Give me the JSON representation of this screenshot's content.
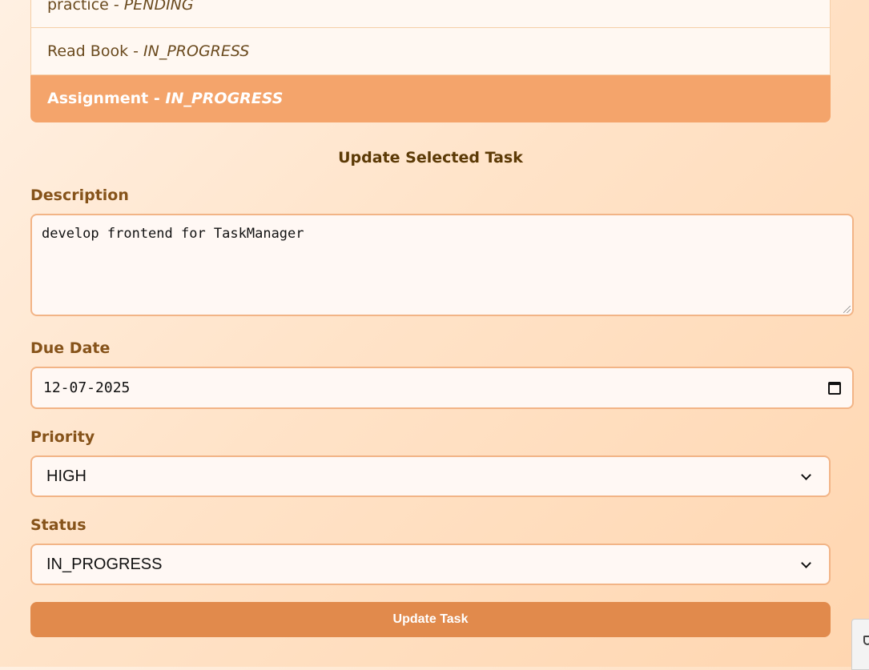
{
  "task_list": {
    "items": [
      {
        "name": "practice",
        "separator": " - ",
        "status": "PENDING",
        "selected": false
      },
      {
        "name": "Read Book",
        "separator": " - ",
        "status": "IN_PROGRESS",
        "selected": false
      },
      {
        "name": "Assignment",
        "separator": " - ",
        "status": "IN_PROGRESS",
        "selected": true
      }
    ]
  },
  "update_form": {
    "heading": "Update Selected Task",
    "description": {
      "label": "Description",
      "value": "develop frontend for TaskManager"
    },
    "due_date": {
      "label": "Due Date",
      "value": "12-07-2025"
    },
    "priority": {
      "label": "Priority",
      "value": "HIGH"
    },
    "status": {
      "label": "Status",
      "value": "IN_PROGRESS"
    },
    "submit_label": "Update Task"
  },
  "colors": {
    "accent": "#f4a46b",
    "button": "#e18a4c",
    "label": "#86531a",
    "border": "#f2b486"
  },
  "icons": {
    "date_picker": "calendar-icon",
    "select_arrow": "chevron-down-icon",
    "corner_widget": "shield-icon"
  }
}
